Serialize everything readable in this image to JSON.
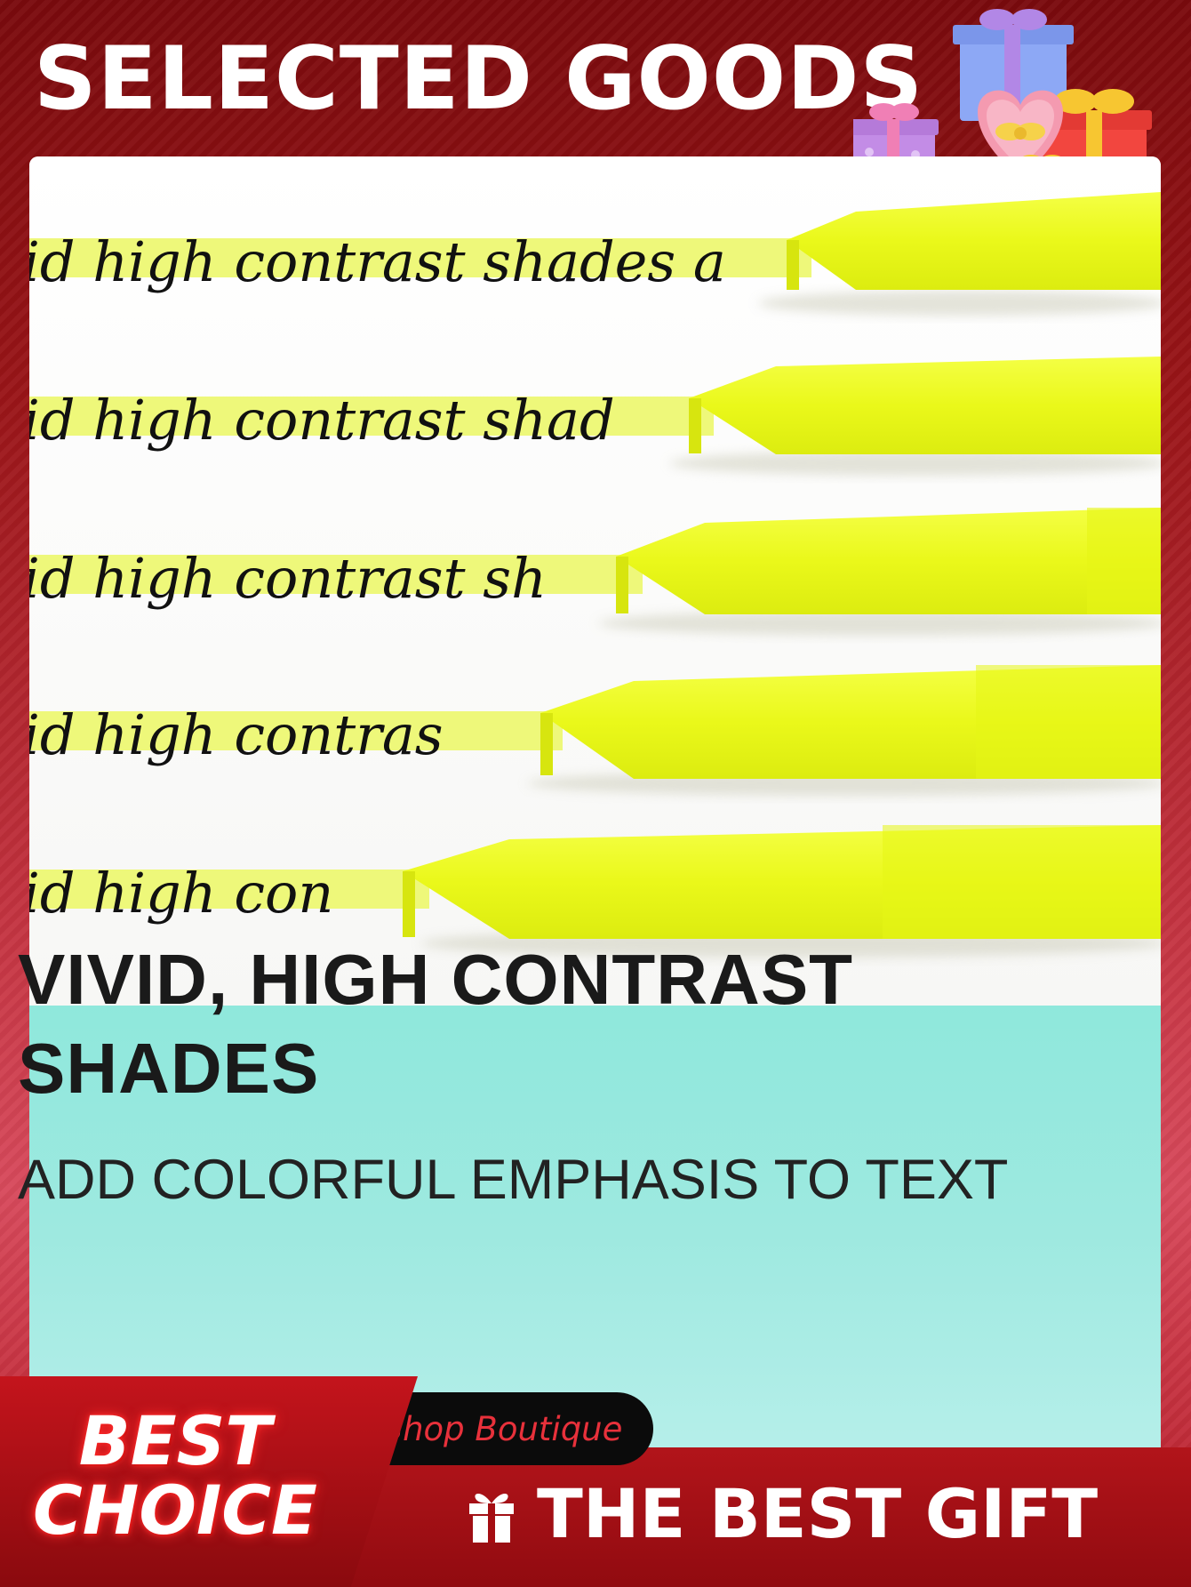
{
  "header": {
    "title": "SELECTED GOODS"
  },
  "product_photo": {
    "handwriting_lines": [
      "id high contrast shades a",
      "id high contrast shad",
      "id high contrast sh",
      "id high contras",
      "id high con"
    ],
    "highlighter_color": "#eefc1a"
  },
  "product_info": {
    "headline_line1": "VIVID, HIGH CONTRAST",
    "headline_line2": "SHADES",
    "subline": "ADD COLORFUL EMPHASIS TO TEXT",
    "panel_color": "#9ee9e0"
  },
  "footer": {
    "shop_label": "Shop Boutique",
    "badge_line1": "BEST",
    "badge_line2": "CHOICE",
    "gift_label": "THE BEST GIFT",
    "gift_icon": "gift-icon"
  },
  "colors": {
    "brand_red": "#b2141a",
    "dark_red": "#7a0a0d",
    "accent_pink": "#d84a5c"
  }
}
